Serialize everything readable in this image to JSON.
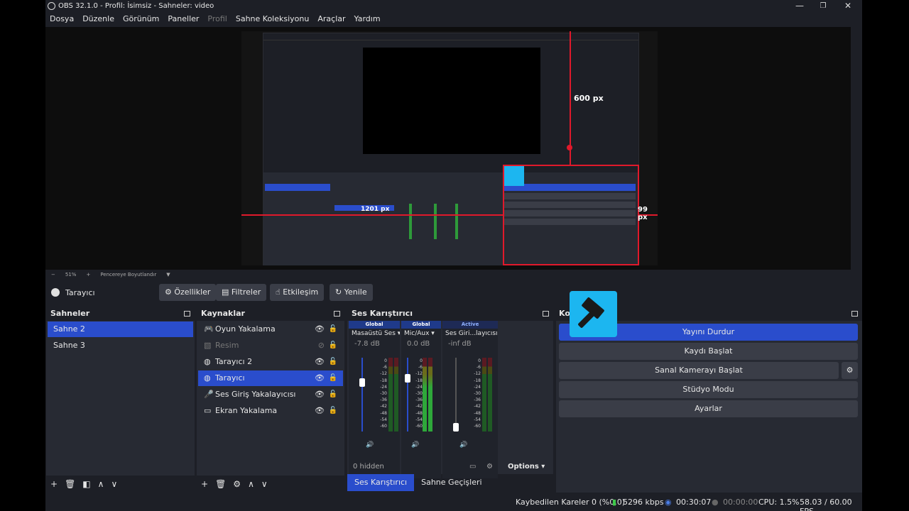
{
  "window": {
    "title": "OBS 32.1.0 - Profil: İsimsiz - Sahneler: video",
    "minimize_icon": "minimize-icon",
    "maximize_icon": "maximize-icon",
    "close_icon": "close-icon"
  },
  "menu": {
    "items": [
      "Dosya",
      "Düzenle",
      "Görünüm",
      "Paneller",
      "Profil",
      "Sahne Koleksiyonu",
      "Araçlar",
      "Yardım"
    ]
  },
  "preview": {
    "dimensions": {
      "height_label": "600 px",
      "width_label": "1201 px",
      "side_label": "99 px"
    },
    "accent_color": "#e0192b"
  },
  "zoombar": {
    "minus": "−",
    "zoom": "51%",
    "plus": "+",
    "fit_label": "Pencereye Boyutlandır"
  },
  "source_toolbar": {
    "source_name": "Tarayıcı",
    "properties": "Özellikler",
    "filters": "Filtreler",
    "interact": "Etkileşim",
    "refresh": "Yenile"
  },
  "scenes": {
    "title": "Sahneler",
    "items": [
      "Sahne 2",
      "Sahne 3"
    ],
    "selected_index": 0
  },
  "sources": {
    "title": "Kaynaklar",
    "items": [
      {
        "name": "Oyun Yakalama",
        "icon": "gamepad-icon",
        "visible": true
      },
      {
        "name": "Resim",
        "icon": "image-icon",
        "visible": false
      },
      {
        "name": "Tarayıcı 2",
        "icon": "globe-icon",
        "visible": true
      },
      {
        "name": "Tarayıcı",
        "icon": "globe-icon",
        "visible": true
      },
      {
        "name": "Ses Giriş Yakalayıcısı",
        "icon": "microphone-icon",
        "visible": true
      },
      {
        "name": "Ekran Yakalama",
        "icon": "monitor-icon",
        "visible": true
      }
    ],
    "selected_index": 3
  },
  "mixer": {
    "title": "Ses Karıştırıcı",
    "channels": [
      {
        "tag": "Global",
        "name": "Masaüstü Ses",
        "db": "-7.8 dB",
        "level": 0.68
      },
      {
        "tag": "Global",
        "name": "Mic/Aux",
        "db": "0.0 dB",
        "level": 0.75
      },
      {
        "tag": "Active",
        "name": "Ses Giri...layıcısı",
        "db": "-inf dB",
        "level": 0.0
      }
    ],
    "scale": [
      "0",
      "-6",
      "-12",
      "-18",
      "-24",
      "-30",
      "-36",
      "-42",
      "-48",
      "-54",
      "-60"
    ],
    "hidden_label": "0 hidden",
    "options_label": "Options"
  },
  "tabs": {
    "mixer": "Ses Karıştırıcı",
    "transitions": "Sahne Geçişleri"
  },
  "controls": {
    "title": "Kontroller",
    "buttons": [
      "Yayını Durdur",
      "Kaydı Başlat",
      "Sanal Kamerayı Başlat",
      "Stüdyo Modu",
      "Ayarlar"
    ]
  },
  "status": {
    "dropped": "Kaybedilen Kareler 0 (%0.0)",
    "bitrate": "5296 kbps",
    "stream_time": "00:30:07",
    "rec_time": "00:00:00",
    "cpu": "CPU: 1.5%",
    "fps": "58.03 / 60.00 FPS"
  }
}
